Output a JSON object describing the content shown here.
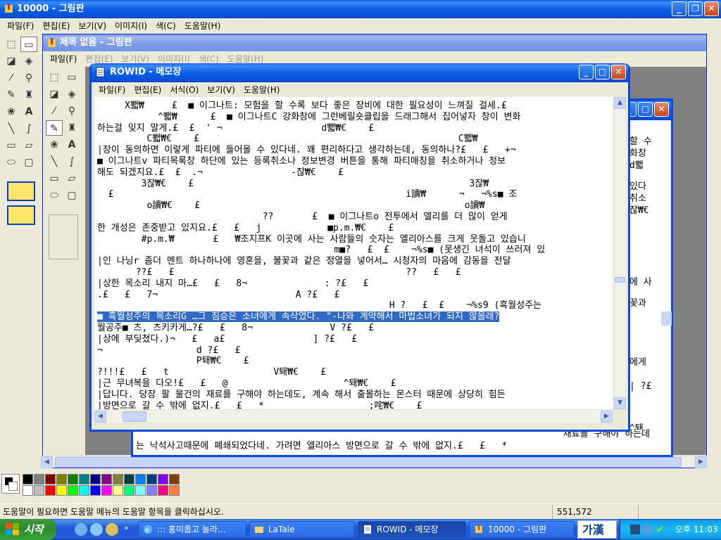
{
  "paint": {
    "title": "10000 - 그림판",
    "menu": [
      "파일(F)",
      "편집(E)",
      "보기(V)",
      "이미지(I)",
      "색(C)",
      "도움말(H)"
    ],
    "status_text": "도움말이 필요하면 도움말 메뉴의 도움말 항목을 클릭하십시오.",
    "coords": "551,572",
    "inner_title": "제목 없음 - 그림판",
    "inner_menu": [
      "파일(F)",
      "편집(E)",
      "보기(V)",
      "이미지(I)",
      "색(C)",
      "도움말(H)"
    ],
    "palette_colors": [
      "#000000",
      "#808080",
      "#800000",
      "#808000",
      "#008000",
      "#008080",
      "#000080",
      "#800080",
      "#808040",
      "#004040",
      "#0080ff",
      "#004080",
      "#8000ff",
      "#804000",
      "#ffffff",
      "#c0c0c0",
      "#ff0000",
      "#ffff00",
      "#00ff00",
      "#00ffff",
      "#0000ff",
      "#ff00ff",
      "#ffff80",
      "#00ff80",
      "#80ffff",
      "#8080ff",
      "#ff0080",
      "#ff8040"
    ]
  },
  "notepad": {
    "title": "ROWID - 메모장",
    "menu": [
      "파일(F)",
      "편집(E)",
      "서식(O)",
      "보기(V)",
      "도움말(H)"
    ],
    "lines": [
      "     X뾃₩     £  ■ 이그나트: 모험을 할 수록 보다 좋은 장비에 대한 필요성이 느껴질 걸세.£",
      "           ^뾃₩      £  ■ 이그나트C 강화창에 그런베릴숏클립을 드래그해서 집어넣자 창이 변화",
      "하는걸 잊지 말게.£  £  ' ¬                  d뾃₩€    £",
      "         C뾃₩€    £                                               C뾃₩",
      "|장이 동의하면 이렇게 파티에 들어올 수 있다네. 꽤 편리하다고 생각하는데, 동의하나?£   £   +¬",
      "■ 이그나트v 파티목록창 하단에 있는 등록취소나 정보변경 버튼을 통해 파티매칭을 취소하거나 정보",
      "해도 되겠지요.£  £  .¬                ‐잖₩€    £",
      "        3잖₩€    £                                                  3잖₩",
      "  £                                                     i讀₩      ¬   ¬%s■ 조",
      "         o讀₩€    £                                                o讀₩",
      "                              ??       £  ■ 이그나트o 전투에서 엘리를 더 많이 얻게",
      "한 개성은 존중받고 있지요.£   £   j            ■p.m.₩€    £",
      "        #p.m.₩       £   ₩조지프K 이곳에 사는 사람들의 숫자는 엘리아스를 크게 웃돌고 있습니",
      "                                           m■?   £  £    ¬%s■ (못생긴 녀석이 쓰러져 있",
      "|인 나닝r 좀더 멘트 하나하나에 영혼을, 불꽃과 같은 정열을 넣어서… 시청자의 마음에 감동을 전달",
      "       ??£   £                                          ??   £   £",
      "|상한 목소리 내지 마…£   £   8¬              : ?£   £",
      ".£   £   7¬                         A ?£   £",
      "                                                     H ?   £  £    ¬%s9 (흑월성주는",
      "■ 흑월성주의 목소리G …그 짐승은 소녀에게 속삭였다. \"-나와 계약해서 마법소녀가 되지 않을래?",
      "월공주■ 츠, 츠키카게…?£   £   8¬              V ?£   £",
      "|상에 부딪쳤다.)¬   £   a£                ] ?£   £",
      "¬                 d ?£   £",
      "                  P퇘₩€    £",
      "?!!!£   £   t                   V퇘₩€    £",
      "|근 무녀복을 다오!£   £   @                     ^퇘₩€    £",
      "|답니다. 당장 팔 물건의 재료를 구해야 하는데도, 계속 해서 출몰하는 몬스터 때문에 상당히 힘든",
      "|방면으로 갈 수 밖에 없지.£   £   *                   ;咤₩€    £"
    ],
    "highlight_line": 19
  },
  "back_notepad": {
    "lines": [
      "할 수",
      "화창",
      "d뾃",
      "있다",
      "취소",
      "잖₩€",
      "에 사",
      "꽃과",
      "에게",
      "| ?£",
      "^퇘",
      "재료를 구해야 하는데",
      "는 낙석사고때문에 폐쇄되었다네. 가려면 엘리아스 방면으로 갈 수 밖에 없지.£   £   *"
    ]
  },
  "taskbar": {
    "start_label": "시작",
    "tasks": [
      {
        "label": "::: 홍미롭고 놀라...",
        "icon": "ie-icon"
      },
      {
        "label": "LaTale",
        "icon": "folder-icon"
      },
      {
        "label": "ROWID - 메모장",
        "icon": "notepad-icon"
      },
      {
        "label": "10000 - 그림판",
        "icon": "paint-icon"
      }
    ],
    "ime": "가漢",
    "clock": "오후 11:03"
  }
}
